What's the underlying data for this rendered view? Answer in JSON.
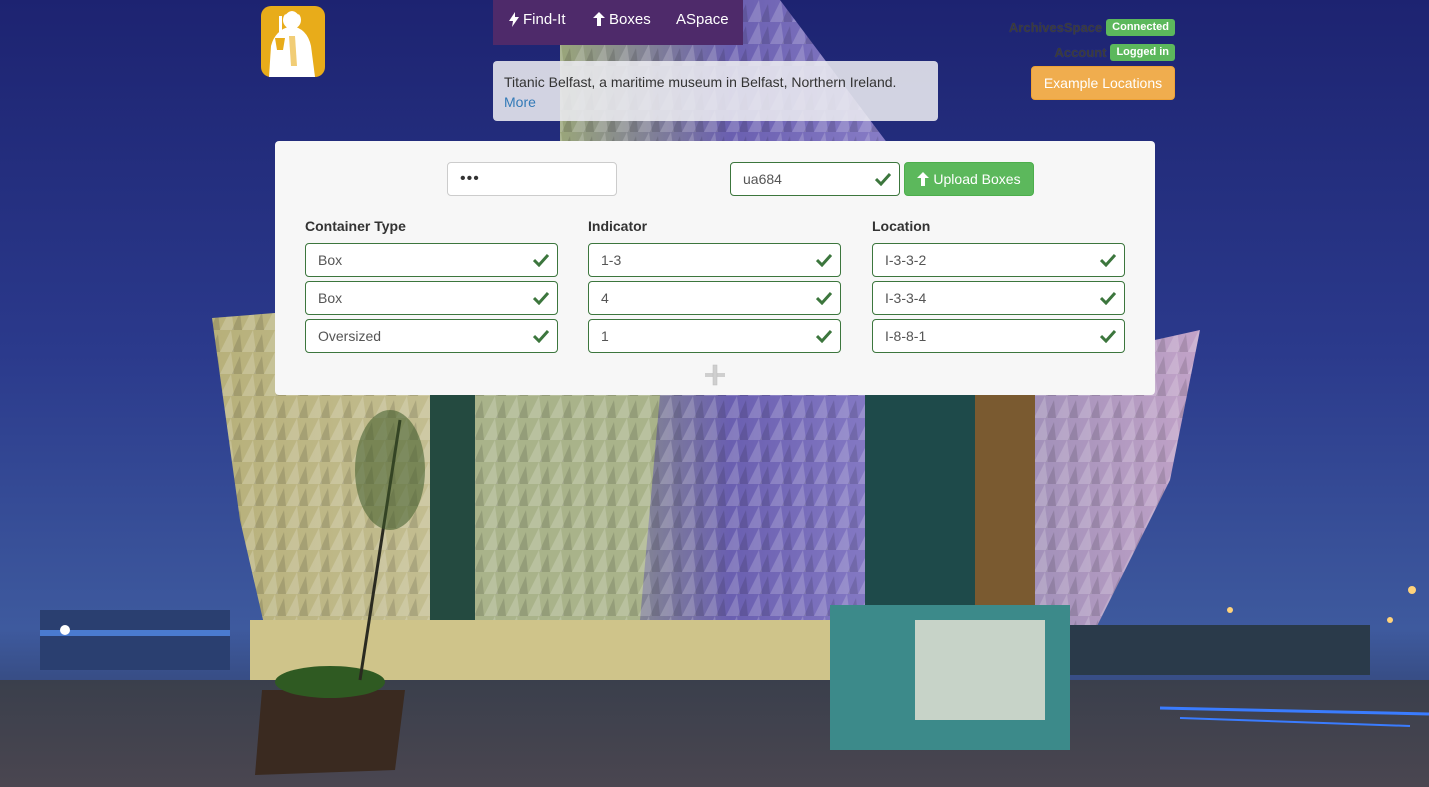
{
  "nav": {
    "findit": "Find-It",
    "boxes": "Boxes",
    "aspace": "ASpace"
  },
  "status": {
    "archivesspace_label": "ArchivesSpace",
    "archivesspace_badge": "Connected",
    "account_label": "Account",
    "account_badge": "Logged in"
  },
  "example_button": "Example Locations",
  "description": {
    "text": "Titanic Belfast, a maritime museum in Belfast, Northern Ireland.",
    "link": "More"
  },
  "form": {
    "password_value": "•••",
    "repository_value": "ua684",
    "upload_label": "Upload Boxes",
    "columns": {
      "container_type": "Container Type",
      "indicator": "Indicator",
      "location": "Location"
    },
    "rows": [
      {
        "container_type": "Box",
        "indicator": "1-3",
        "location": "I-3-3-2"
      },
      {
        "container_type": "Box",
        "indicator": "4",
        "location": "I-3-3-4"
      },
      {
        "container_type": "Oversized",
        "indicator": "1",
        "location": "I-8-8-1"
      }
    ]
  },
  "colors": {
    "nav_bg": "#4e2a6a",
    "success": "#5cb85c",
    "warning": "#f0ad4e",
    "valid_border": "#3c763d",
    "link": "#337ab7"
  },
  "icons": [
    "bolt-icon",
    "upload-icon",
    "check-icon",
    "plus-icon",
    "logo-icon"
  ]
}
